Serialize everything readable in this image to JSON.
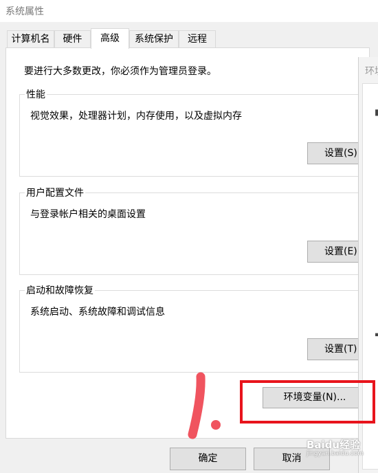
{
  "window": {
    "title": "系统属性"
  },
  "tabs": [
    {
      "label": "计算机名"
    },
    {
      "label": "硬件"
    },
    {
      "label": "高级"
    },
    {
      "label": "系统保护"
    },
    {
      "label": "远程"
    }
  ],
  "active_tab": "高级",
  "notice": "要进行大多数更改，你必须作为管理员登录。",
  "groups": {
    "performance": {
      "title": "性能",
      "description": "视觉效果，处理器计划，内存使用，以及虚拟内存",
      "button": "设置(S)..."
    },
    "user_profiles": {
      "title": "用户配置文件",
      "description": "与登录帐户相关的桌面设置",
      "button": "设置(E)..."
    },
    "startup_recovery": {
      "title": "启动和故障恢复",
      "description": "系统启动、系统故障和调试信息",
      "button": "设置(T)..."
    }
  },
  "env_button": "环境变量(N)...",
  "footer": {
    "ok": "确定",
    "cancel": "取消"
  },
  "background_window": {
    "title": "环境变量"
  },
  "annotation": {
    "mark": "1.",
    "color": "#f0545f",
    "highlight_color": "#e8141c"
  },
  "watermark": {
    "brand": "Baidu经验",
    "url": "jingyan.baidu.com"
  }
}
